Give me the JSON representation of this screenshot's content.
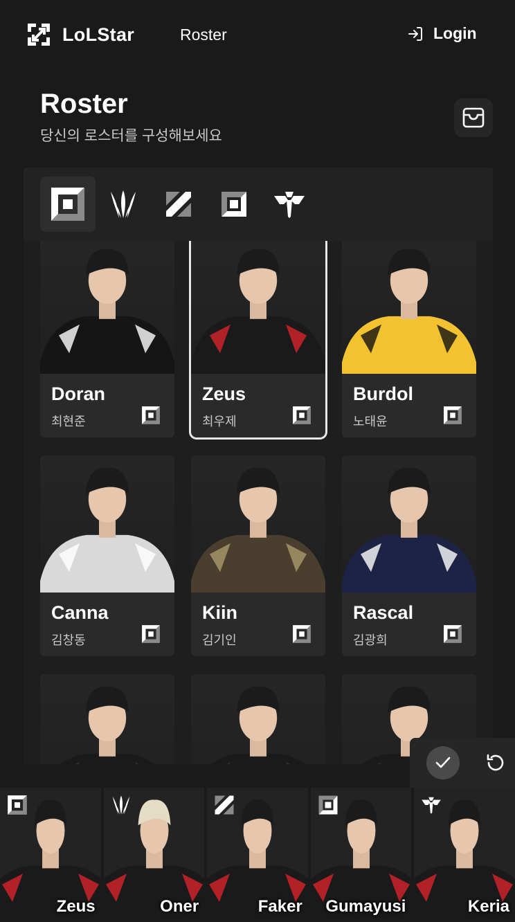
{
  "header": {
    "app_name": "LoLStar",
    "nav_roster": "Roster",
    "login_label": "Login"
  },
  "page": {
    "title": "Roster",
    "subtitle": "당신의 로스터를 구성해보세요"
  },
  "filters": [
    {
      "icon": "top-lane-icon",
      "active": true
    },
    {
      "icon": "jungle-icon",
      "active": false
    },
    {
      "icon": "mid-lane-icon",
      "active": false
    },
    {
      "icon": "bot-lane-icon",
      "active": false
    },
    {
      "icon": "support-icon",
      "active": false
    }
  ],
  "players": [
    {
      "name": "Doran",
      "korean_name": "최현준",
      "role_icon": "top-lane-icon",
      "selected": false,
      "jersey": "#151515",
      "accent": "#ffffff"
    },
    {
      "name": "Zeus",
      "korean_name": "최우제",
      "role_icon": "top-lane-icon",
      "selected": true,
      "jersey": "#1a1a1a",
      "accent": "#d8232a"
    },
    {
      "name": "Burdol",
      "korean_name": "노태윤",
      "role_icon": "top-lane-icon",
      "selected": false,
      "jersey": "#f2c230",
      "accent": "#111111"
    },
    {
      "name": "Canna",
      "korean_name": "김창동",
      "role_icon": "top-lane-icon",
      "selected": false,
      "jersey": "#d9d9d9",
      "accent": "#ffffff"
    },
    {
      "name": "Kiin",
      "korean_name": "김기인",
      "role_icon": "top-lane-icon",
      "selected": false,
      "jersey": "#4a3f2e",
      "accent": "#a99a6a"
    },
    {
      "name": "Rascal",
      "korean_name": "김광희",
      "role_icon": "top-lane-icon",
      "selected": false,
      "jersey": "#1c2344",
      "accent": "#ffffff"
    }
  ],
  "lineup": [
    {
      "name": "Zeus",
      "role_icon": "top-lane-icon"
    },
    {
      "name": "Oner",
      "role_icon": "jungle-icon"
    },
    {
      "name": "Faker",
      "role_icon": "mid-lane-icon"
    },
    {
      "name": "Gumayusi",
      "role_icon": "bot-lane-icon"
    },
    {
      "name": "Keria",
      "role_icon": "support-icon"
    }
  ],
  "colors": {
    "background": "#1a1a1a",
    "card": "#2a2a2a",
    "selected_outline": "#e8e8e8",
    "team_red": "#d8232a"
  }
}
